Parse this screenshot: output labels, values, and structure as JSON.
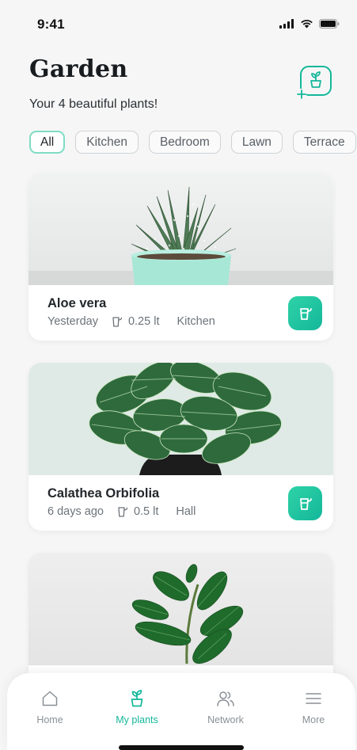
{
  "status": {
    "time": "9:41"
  },
  "header": {
    "title": "Garden",
    "subtitle": "Your 4 beautiful plants!"
  },
  "filters": [
    {
      "label": "All",
      "selected": true
    },
    {
      "label": "Kitchen",
      "selected": false
    },
    {
      "label": "Bedroom",
      "selected": false
    },
    {
      "label": "Lawn",
      "selected": false
    },
    {
      "label": "Terrace",
      "selected": false
    }
  ],
  "plants": [
    {
      "name": "Aloe vera",
      "last_watered": "Yesterday",
      "water": "0.25 lt",
      "room": "Kitchen"
    },
    {
      "name": "Calathea Orbifolia",
      "last_watered": "6 days ago",
      "water": "0.5 lt",
      "room": "Hall"
    },
    {
      "name": "",
      "last_watered": "",
      "water": "",
      "room": ""
    }
  ],
  "tabs": [
    {
      "label": "Home",
      "icon": "home-icon",
      "active": false
    },
    {
      "label": "My plants",
      "icon": "sprout-icon",
      "active": true
    },
    {
      "label": "Network",
      "icon": "people-icon",
      "active": false
    },
    {
      "label": "More",
      "icon": "menu-icon",
      "active": false
    }
  ],
  "colors": {
    "accent": "#14b79a",
    "accent_light": "#7fdcc4",
    "background": "#f6f6f6"
  }
}
